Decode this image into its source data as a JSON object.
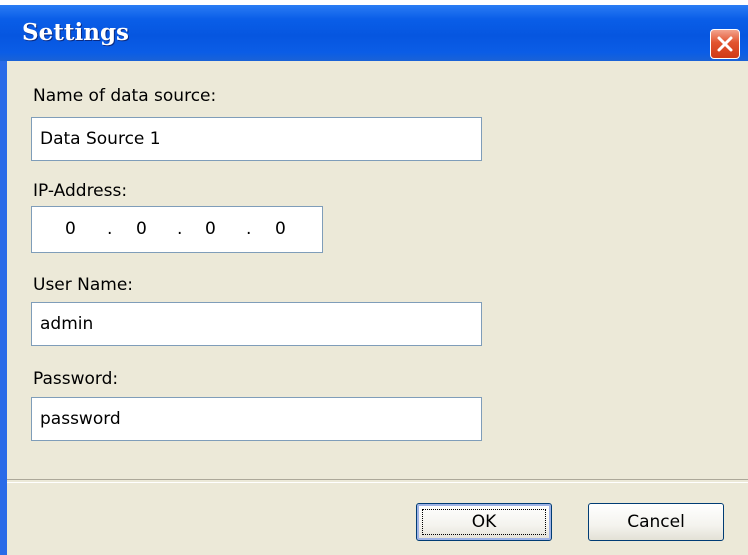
{
  "window": {
    "title": "Settings"
  },
  "form": {
    "datasource_label": "Name of data source:",
    "datasource_value": "Data Source 1",
    "ip_label": "IP-Address:",
    "ip_octets": [
      "0",
      "0",
      "0",
      "0"
    ],
    "ip_separators": [
      ".",
      ".",
      "."
    ],
    "username_label": "User Name:",
    "username_value": "admin",
    "password_label": "Password:",
    "password_value": "password"
  },
  "buttons": {
    "ok_label": "OK",
    "cancel_label": "Cancel"
  },
  "icons": {
    "close": "close-icon"
  },
  "colors": {
    "titlebar": "#0656e0",
    "close_button": "#e2532e",
    "dialog_bg": "#ece9d8"
  }
}
